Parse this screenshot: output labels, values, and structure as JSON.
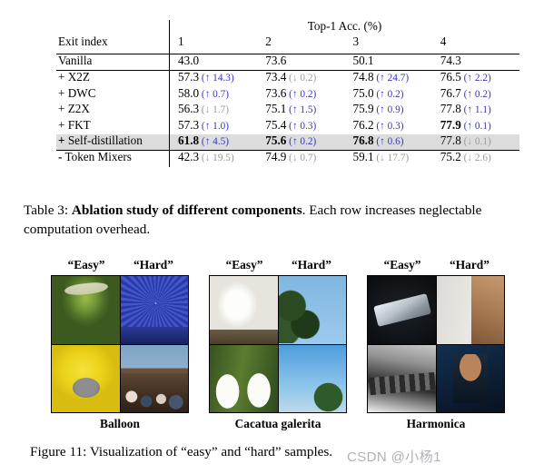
{
  "table": {
    "span_header": "Top-1 Acc. (%)",
    "row_header_label": "Exit index",
    "columns": [
      "1",
      "2",
      "3",
      "4"
    ],
    "rows": [
      {
        "label": "Vanilla",
        "label_bold": false,
        "highlight": false,
        "cells": [
          {
            "value": "43.0",
            "bold": false,
            "delta": "",
            "dir": ""
          },
          {
            "value": "73.6",
            "bold": false,
            "delta": "",
            "dir": ""
          },
          {
            "value": "50.1",
            "bold": false,
            "delta": "",
            "dir": ""
          },
          {
            "value": "74.3",
            "bold": false,
            "delta": "",
            "dir": ""
          }
        ]
      },
      {
        "label": "+ X2Z",
        "label_bold": true,
        "highlight": false,
        "cells": [
          {
            "value": "57.3",
            "bold": false,
            "delta": "14.3",
            "dir": "up"
          },
          {
            "value": "73.4",
            "bold": false,
            "delta": "0.2",
            "dir": "down"
          },
          {
            "value": "74.8",
            "bold": false,
            "delta": "24.7",
            "dir": "up"
          },
          {
            "value": "76.5",
            "bold": false,
            "delta": "2.2",
            "dir": "up"
          }
        ]
      },
      {
        "label": "+ DWC",
        "label_bold": true,
        "highlight": false,
        "cells": [
          {
            "value": "58.0",
            "bold": false,
            "delta": "0.7",
            "dir": "up"
          },
          {
            "value": "73.6",
            "bold": false,
            "delta": "0.2",
            "dir": "up"
          },
          {
            "value": "75.0",
            "bold": false,
            "delta": "0.2",
            "dir": "up"
          },
          {
            "value": "76.7",
            "bold": false,
            "delta": "0.2",
            "dir": "up"
          }
        ]
      },
      {
        "label": "+ Z2X",
        "label_bold": true,
        "highlight": false,
        "cells": [
          {
            "value": "56.3",
            "bold": false,
            "delta": "1.7",
            "dir": "down"
          },
          {
            "value": "75.1",
            "bold": false,
            "delta": "1.5",
            "dir": "up"
          },
          {
            "value": "75.9",
            "bold": false,
            "delta": "0.9",
            "dir": "up"
          },
          {
            "value": "77.8",
            "bold": false,
            "delta": "1.1",
            "dir": "up"
          }
        ]
      },
      {
        "label": "+ FKT",
        "label_bold": true,
        "highlight": false,
        "cells": [
          {
            "value": "57.3",
            "bold": false,
            "delta": "1.0",
            "dir": "up"
          },
          {
            "value": "75.4",
            "bold": false,
            "delta": "0.3",
            "dir": "up"
          },
          {
            "value": "76.2",
            "bold": false,
            "delta": "0.3",
            "dir": "up"
          },
          {
            "value": "77.9",
            "bold": true,
            "delta": "0.1",
            "dir": "up"
          }
        ]
      },
      {
        "label": "+ Self-distillation",
        "label_bold": false,
        "highlight": true,
        "cells": [
          {
            "value": "61.8",
            "bold": true,
            "delta": "4.5",
            "dir": "up"
          },
          {
            "value": "75.6",
            "bold": true,
            "delta": "0.2",
            "dir": "up"
          },
          {
            "value": "76.8",
            "bold": true,
            "delta": "0.6",
            "dir": "up"
          },
          {
            "value": "77.8",
            "bold": false,
            "delta": "0.1",
            "dir": "down"
          }
        ]
      },
      {
        "label": "- Token Mixers",
        "label_bold": false,
        "highlight": false,
        "cells": [
          {
            "value": "42.3",
            "bold": false,
            "delta": "19.5",
            "dir": "down"
          },
          {
            "value": "74.9",
            "bold": false,
            "delta": "0.7",
            "dir": "down"
          },
          {
            "value": "59.1",
            "bold": false,
            "delta": "17.7",
            "dir": "down"
          },
          {
            "value": "75.2",
            "bold": false,
            "delta": "2.6",
            "dir": "down"
          }
        ]
      }
    ],
    "caption": {
      "prefix": "Table 3:",
      "bold_title": "Ablation study of different components",
      "rest": ". Each row increases neglectable computation overhead."
    },
    "colors": {
      "delta_up": "#3634cb",
      "delta_down": "#9b9b9b",
      "highlight_row": "#dcdcdc"
    }
  },
  "figure": {
    "groups": [
      {
        "easy_label": "“Easy”",
        "hard_label": "“Hard”",
        "class_label": "Balloon",
        "images": [
          "green-hot-air-balloon-photo",
          "blue-ferris-wheel-photo",
          "yellow-character-balloon-photo",
          "balloon-basket-crowd-photo"
        ]
      },
      {
        "easy_label": "“Easy”",
        "hard_label": "“Hard”",
        "class_label": "Cacatua galerita",
        "images": [
          "perched-white-cockatoo-photo",
          "cockatoos-in-bare-tree-photo",
          "two-cockatoos-feeding-photo",
          "cockatoo-flying-in-sky-photo"
        ]
      },
      {
        "easy_label": "“Easy”",
        "hard_label": "“Hard”",
        "class_label": "Harmonica",
        "images": [
          "harmonica-on-dark-background-photo",
          "man-playing-harmonica-at-mic-photo",
          "harmonica-black-and-white-closeup-photo",
          "singer-playing-harmonica-on-stage-photo"
        ]
      }
    ],
    "caption": "Figure 11: Visualization of “easy” and “hard” samples."
  },
  "watermark": {
    "text": "CSDN @小杨1"
  }
}
